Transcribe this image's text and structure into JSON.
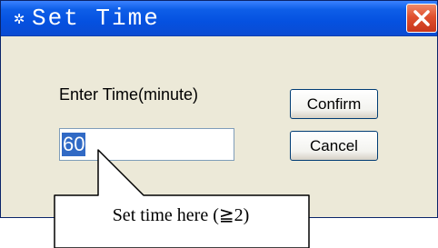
{
  "window": {
    "title": "Set Time",
    "title_icon": "gear-icon",
    "close_icon": "close-icon"
  },
  "form": {
    "label": "Enter Time(minute)",
    "value": "60",
    "value_selected": true
  },
  "buttons": {
    "confirm": "Confirm",
    "cancel": "Cancel"
  },
  "callout": {
    "text": "Set time here (≧2)"
  },
  "colors": {
    "titlebar": "#0551e0",
    "close_button": "#e0502e",
    "dialog_bg": "#ece9d8",
    "selection": "#316ac5"
  }
}
